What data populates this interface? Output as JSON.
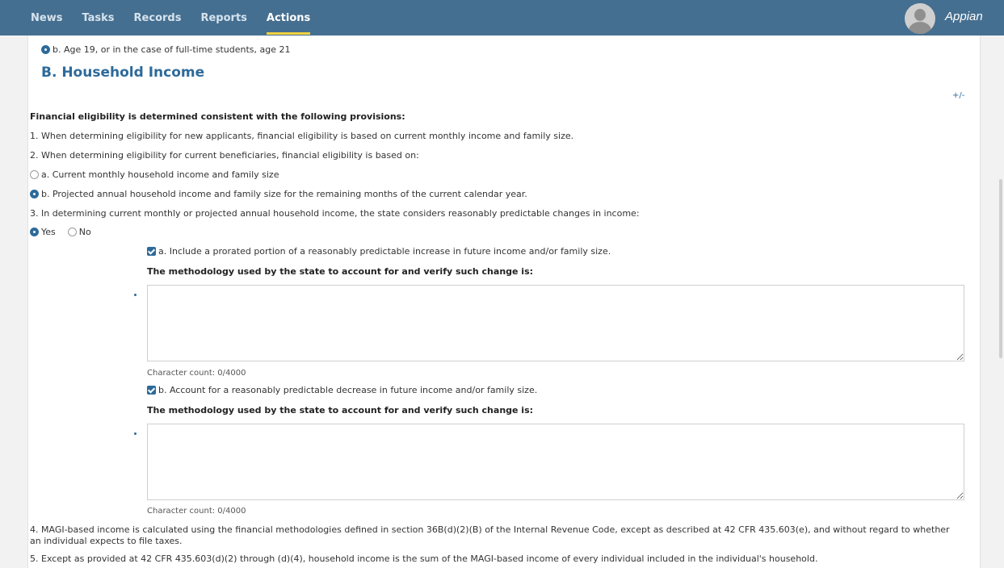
{
  "nav": {
    "items": [
      "News",
      "Tasks",
      "Records",
      "Reports",
      "Actions"
    ],
    "active_index": 4
  },
  "brand": {
    "name": "Appian"
  },
  "content": {
    "prev_option": "b. Age 19, or in the case of full-time students, age 21",
    "section_title": "B. Household Income",
    "toggle": "+/-",
    "intro": "Financial eligibility is determined consistent with the following provisions:",
    "item1": "1. When determining eligibility for new applicants, financial eligibility is based on current monthly income and family size.",
    "item2": "2. When determining eligibility for current beneficiaries, financial eligibility is based on:",
    "item2_option_a": "a. Current monthly household income and family size",
    "item2_option_b": "b. Projected annual household income and family size for the remaining months of the current calendar year.",
    "item2_selected": "b",
    "item3": "3. In determining current monthly or projected annual household income, the state considers reasonably predictable changes in income:",
    "yes_label": "Yes",
    "no_label": "No",
    "item3_selected": "Yes",
    "check_a_label": "a. Include a prorated portion of a reasonably predictable increase in future income and/or family size.",
    "check_a_checked": true,
    "methodology_label_1": "The methodology used by the state to account for and verify such change is:",
    "textarea_1_value": "",
    "char_count_1": "Character count: 0/4000",
    "check_b_label": "b. Account for a reasonably predictable decrease in future income and/or family size.",
    "check_b_checked": true,
    "methodology_label_2": "The methodology used by the state to account for and verify such change is:",
    "textarea_2_value": "",
    "char_count_2": "Character count: 0/4000",
    "item4": "4. MAGI-based income is calculated using the financial methodologies defined in section 36B(d)(2)(B) of the Internal Revenue Code, except as described at 42 CFR 435.603(e), and without regard to whether an individual expects to file taxes.",
    "item5": "5. Except as provided at 42 CFR 435.603(d)(2) through (d)(4), household income is the sum of the MAGI-based income of every individual included in the individual's household."
  },
  "colors": {
    "header_bg": "#456f90",
    "accent": "#2d6a9a",
    "active_underline": "#f2d23d"
  }
}
